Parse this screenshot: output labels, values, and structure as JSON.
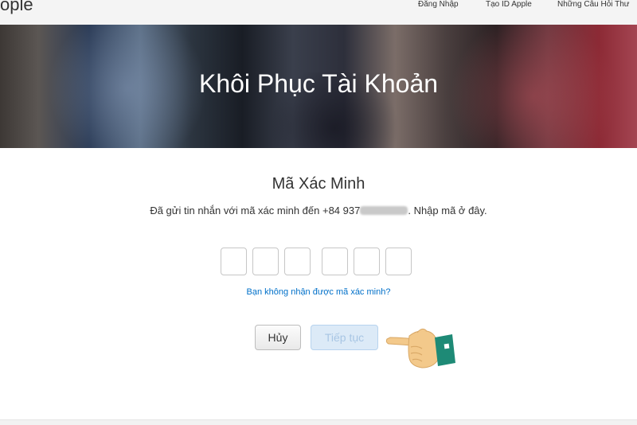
{
  "header": {
    "brand": "ople",
    "nav": [
      "Đăng Nhập",
      "Tạo ID Apple",
      "Những Câu Hỏi Thư"
    ]
  },
  "hero": {
    "title": "Khôi Phục Tài Khoản"
  },
  "verify": {
    "title": "Mã Xác Minh",
    "desc_before": "Đã gửi tin nhắn với mã xác minh đến +84 937",
    "desc_after": ". Nhập mã ở đây.",
    "code_digits": [
      "",
      "",
      "",
      "",
      "",
      ""
    ],
    "resend_link": "Bạn không nhận được mã xác minh?"
  },
  "buttons": {
    "cancel": "Hủy",
    "continue": "Tiếp tục"
  },
  "icons": {
    "pointer": "pointing-hand-icon"
  },
  "colors": {
    "link": "#0070c9",
    "continue_bg": "#dceaf7",
    "cuff": "#1e8a76",
    "skin": "#f3c98b"
  }
}
